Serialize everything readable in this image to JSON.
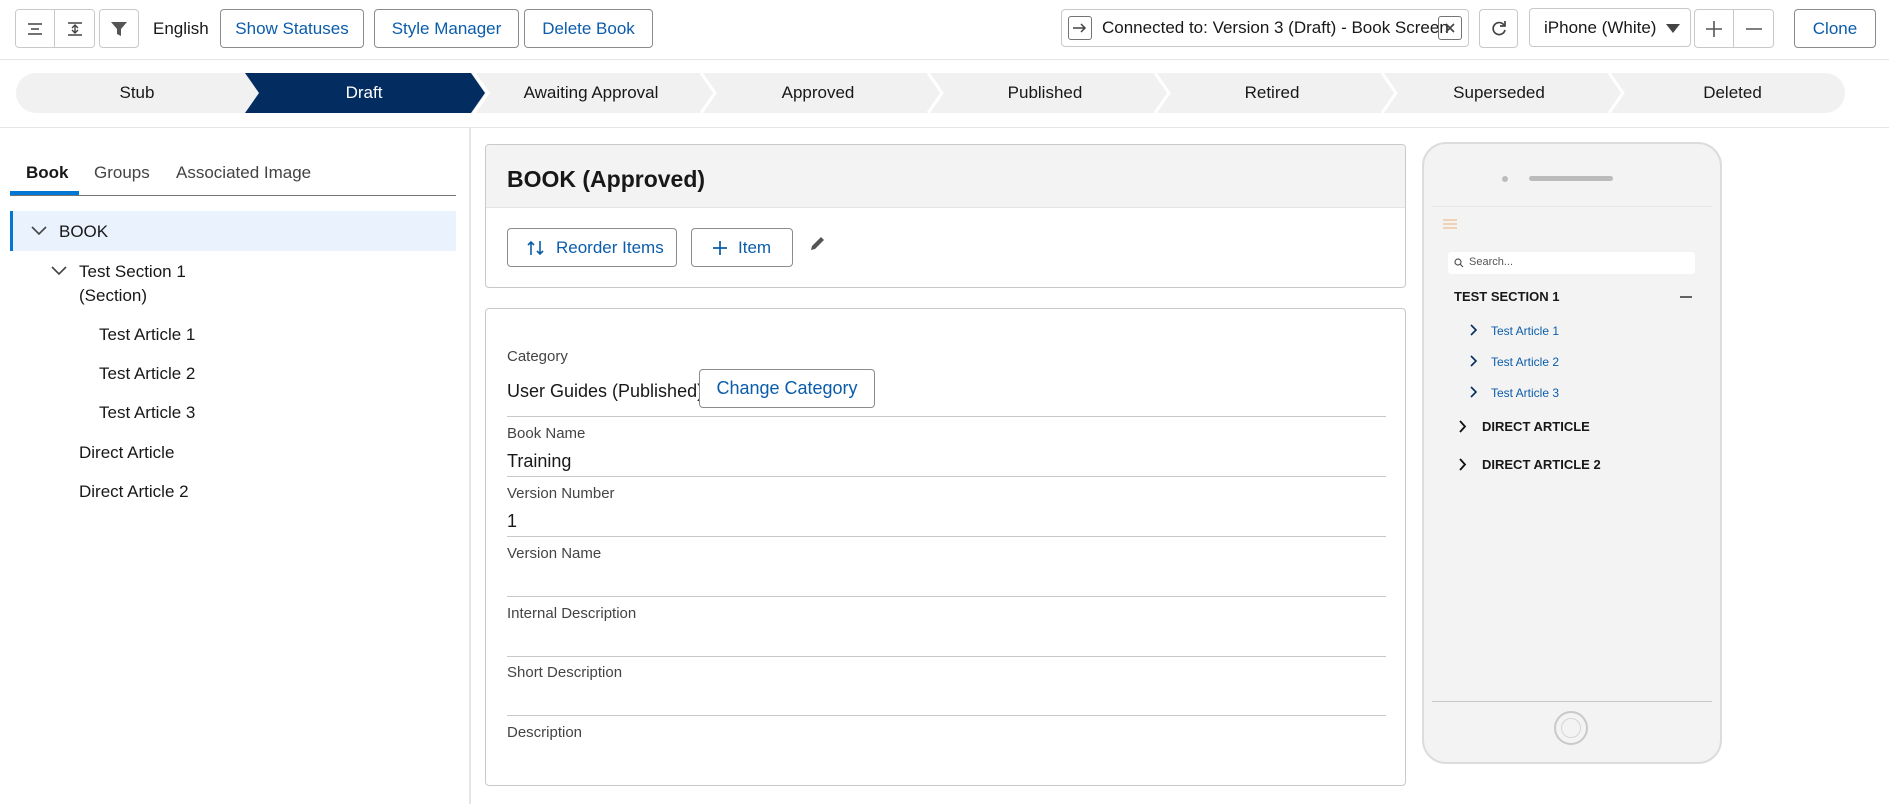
{
  "toolbar": {
    "icon_names": [
      "collapse-all-icon",
      "expand-all-icon",
      "filter-icon"
    ],
    "language": "English",
    "show_statuses": "Show Statuses",
    "style_manager": "Style Manager",
    "delete_book": "Delete Book",
    "connected": "Connected to: Version 3 (Draft) - Book Screen",
    "device": "iPhone (White)",
    "clone": "Clone"
  },
  "path": {
    "stages": [
      "Stub",
      "Draft",
      "Awaiting Approval",
      "Approved",
      "Published",
      "Retired",
      "Superseded",
      "Deleted"
    ],
    "active": "Draft",
    "active_color": "#032d60"
  },
  "left": {
    "tabs": [
      "Book",
      "Groups",
      "Associated Image"
    ],
    "active_tab": "Book",
    "tree": {
      "root": "BOOK",
      "section": "Test Section 1",
      "section_type": "(Section)",
      "articles": [
        "Test Article 1",
        "Test Article 2",
        "Test Article 3"
      ],
      "direct": [
        "Direct Article",
        "Direct Article 2"
      ]
    }
  },
  "center": {
    "title": "BOOK  (Approved)",
    "reorder": "Reorder Items",
    "item": "Item",
    "fields": {
      "category_label": "Category",
      "category_value": "User Guides (Published)",
      "change_category": "Change Category",
      "book_name_label": "Book Name",
      "book_name_value": "Training",
      "version_number_label": "Version Number",
      "version_number_value": "1",
      "version_name_label": "Version Name",
      "internal_desc_label": "Internal Description",
      "short_desc_label": "Short Description",
      "desc_label": "Description"
    }
  },
  "phone": {
    "search_placeholder": "Search...",
    "section": "TEST SECTION 1",
    "articles": [
      "Test Article 1",
      "Test Article 2",
      "Test Article 3"
    ],
    "direct": [
      "DIRECT ARTICLE",
      "DIRECT ARTICLE 2"
    ]
  },
  "colors": {
    "brand_blue": "#0b5cab",
    "accent": "#0176d3",
    "active_stage": "#032d60"
  }
}
